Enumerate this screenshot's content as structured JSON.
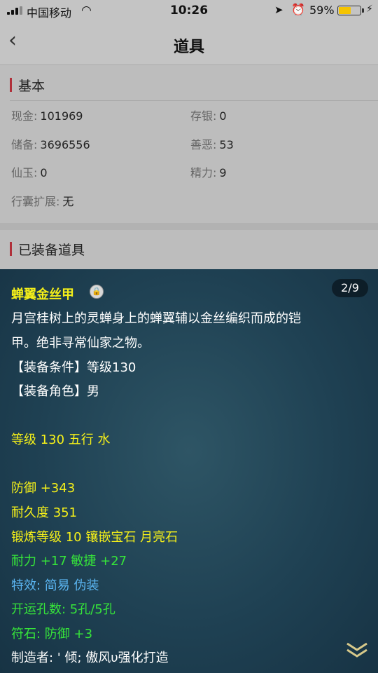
{
  "status_bar": {
    "carrier": "中国移动",
    "time": "10:26",
    "battery_percent": "59%",
    "battery_level": 0.59
  },
  "header": {
    "title": "道具"
  },
  "basic": {
    "title": "基本",
    "items": [
      {
        "label": "现金:",
        "value": "101969"
      },
      {
        "label": "存银:",
        "value": "0"
      },
      {
        "label": "储备:",
        "value": "3696556"
      },
      {
        "label": "善恶:",
        "value": "53"
      },
      {
        "label": "仙玉:",
        "value": "0"
      },
      {
        "label": "精力:",
        "value": "9"
      },
      {
        "label": "行囊扩展:",
        "value": "无"
      }
    ]
  },
  "equipped": {
    "title": "已装备道具"
  },
  "item_tooltip": {
    "name": "蝉翼金丝甲",
    "page": "2/9",
    "desc_line1": "月宫桂树上的灵蝉身上的蝉翼辅以金丝编织而成的铠",
    "desc_line2": "甲。绝非寻常仙家之物。",
    "req_level": "【装备条件】等级130",
    "req_role": "【装备角色】男",
    "level_element": "等级 130 五行 水",
    "defense": "防御 +343",
    "durability": "耐久度 351",
    "forge": "锻炼等级 10 镶嵌宝石 月亮石",
    "stats": "耐力 +17 敏捷 +27",
    "special": "特效: 简易 伪装",
    "holes": "开运孔数: 5孔/5孔",
    "rune": "符石: 防御 +3",
    "maker": "制造者: ' 倾; 傲风υ强化打造"
  }
}
